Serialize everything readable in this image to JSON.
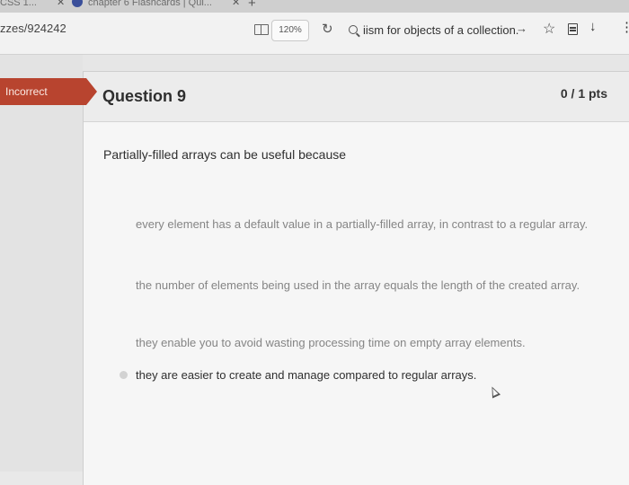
{
  "browser": {
    "tabs": [
      {
        "label": "CSS 1...",
        "close": "✕"
      },
      {
        "label": "chapter 6 Flashcards | Qui...",
        "close": "✕"
      }
    ],
    "new_tab": "+",
    "url_fragment": "zzes/924242",
    "zoom": "120%",
    "search_text": "iism for objects of a collection."
  },
  "quiz": {
    "status_label": "Incorrect",
    "question_title": "Question 9",
    "points": "0 / 1 pts",
    "question_text": "Partially-filled arrays can be useful because",
    "answers": [
      "every element has a default value in a partially-filled array, in contrast to a regular array.",
      "the number of elements being used in the array equals the length of the created array.",
      "they enable you to avoid wasting processing time on empty array elements.",
      "they are easier to create and manage compared to regular arrays."
    ]
  },
  "colors": {
    "incorrect": "#b8442f",
    "card": "#f6f6f6",
    "faded_text": "#858585"
  }
}
